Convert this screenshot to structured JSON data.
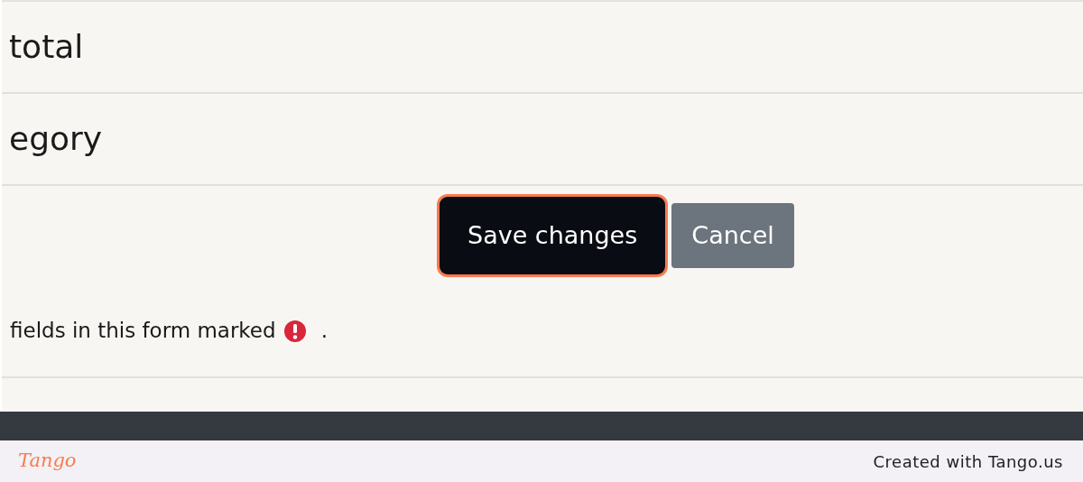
{
  "form_rows": [
    {
      "label": "total"
    },
    {
      "label": "egory"
    }
  ],
  "buttons": [
    {
      "label": "Save changes",
      "kind": "primary",
      "highlighted": true
    },
    {
      "label": "Cancel",
      "kind": "secondary",
      "highlighted": false
    }
  ],
  "note": {
    "text": "fields in this form marked",
    "end": "."
  },
  "footer": {
    "logo": "Tango",
    "credit": "Created with Tango.us"
  }
}
